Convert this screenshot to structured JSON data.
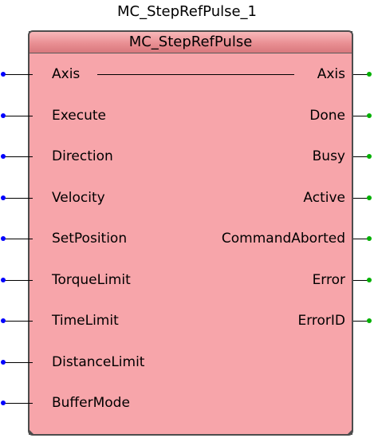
{
  "instance_name": "MC_StepRefPulse_1",
  "function_block": {
    "type_name": "MC_StepRefPulse",
    "inputs": [
      {
        "label": "Axis"
      },
      {
        "label": "Execute"
      },
      {
        "label": "Direction"
      },
      {
        "label": "Velocity"
      },
      {
        "label": "SetPosition"
      },
      {
        "label": "TorqueLimit"
      },
      {
        "label": "TimeLimit"
      },
      {
        "label": "DistanceLimit"
      },
      {
        "label": "BufferMode"
      }
    ],
    "outputs": [
      {
        "label": "Axis"
      },
      {
        "label": "Done"
      },
      {
        "label": "Busy"
      },
      {
        "label": "Active"
      },
      {
        "label": "CommandAborted"
      },
      {
        "label": "Error"
      },
      {
        "label": "ErrorID"
      }
    ]
  },
  "colors": {
    "block_fill": "#f7a5aa",
    "header_fill": "#e98f93",
    "input_pin": "#0000ff",
    "output_pin": "#00b000",
    "border": "#4d4d4d"
  }
}
